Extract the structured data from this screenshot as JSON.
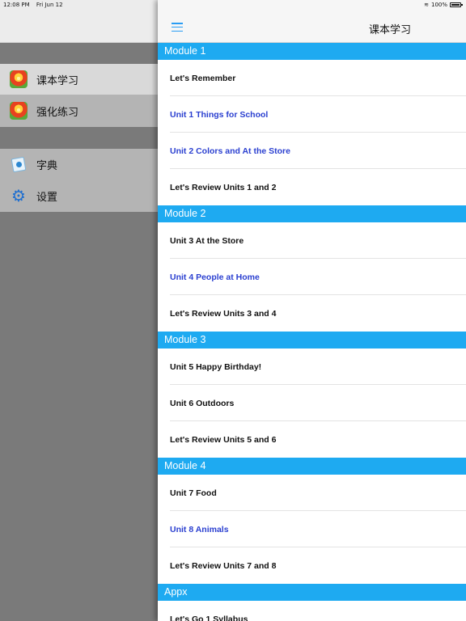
{
  "status_bar": {
    "time": "12:08 PM",
    "date": "Fri Jun 12",
    "battery": "100%",
    "battery_level": 1.0
  },
  "sidebar": {
    "group1": [
      {
        "label": "课本学习",
        "icon": "app-icon",
        "active": true
      },
      {
        "label": "强化练习",
        "icon": "app-icon",
        "active": false
      }
    ],
    "group2": [
      {
        "label": "字典",
        "icon": "dictionary-icon",
        "active": false
      },
      {
        "label": "设置",
        "icon": "gear-icon",
        "active": false
      }
    ]
  },
  "nav": {
    "title": "课本学习",
    "menu_icon": "hamburger-menu-icon"
  },
  "colors": {
    "accent": "#1eaaf1",
    "link_blue": "#2a3fd0",
    "menu_blue": "#2a9df4"
  },
  "sections": [
    {
      "header": "Module 1",
      "rows": [
        {
          "label": "Let's Remember",
          "highlight": false
        },
        {
          "label": "Unit 1 Things for School",
          "highlight": true
        },
        {
          "label": "Unit 2 Colors and At the Store",
          "highlight": true
        },
        {
          "label": "Let's Review Units 1 and 2",
          "highlight": false
        }
      ]
    },
    {
      "header": "Module 2",
      "rows": [
        {
          "label": "Unit 3 At the Store",
          "highlight": false
        },
        {
          "label": "Unit 4 People at Home",
          "highlight": true
        },
        {
          "label": "Let's Review Units 3 and 4",
          "highlight": false
        }
      ]
    },
    {
      "header": "Module 3",
      "rows": [
        {
          "label": "Unit 5 Happy Birthday!",
          "highlight": false
        },
        {
          "label": "Unit 6 Outdoors",
          "highlight": false
        },
        {
          "label": "Let's Review Units 5 and 6",
          "highlight": false
        }
      ]
    },
    {
      "header": "Module 4",
      "rows": [
        {
          "label": "Unit 7 Food",
          "highlight": false
        },
        {
          "label": "Unit 8 Animals",
          "highlight": true
        },
        {
          "label": "Let's Review Units 7 and 8",
          "highlight": false
        }
      ]
    },
    {
      "header": "Appx",
      "rows": [
        {
          "label": "Let's Go 1 Syllabus",
          "highlight": false
        }
      ]
    }
  ]
}
